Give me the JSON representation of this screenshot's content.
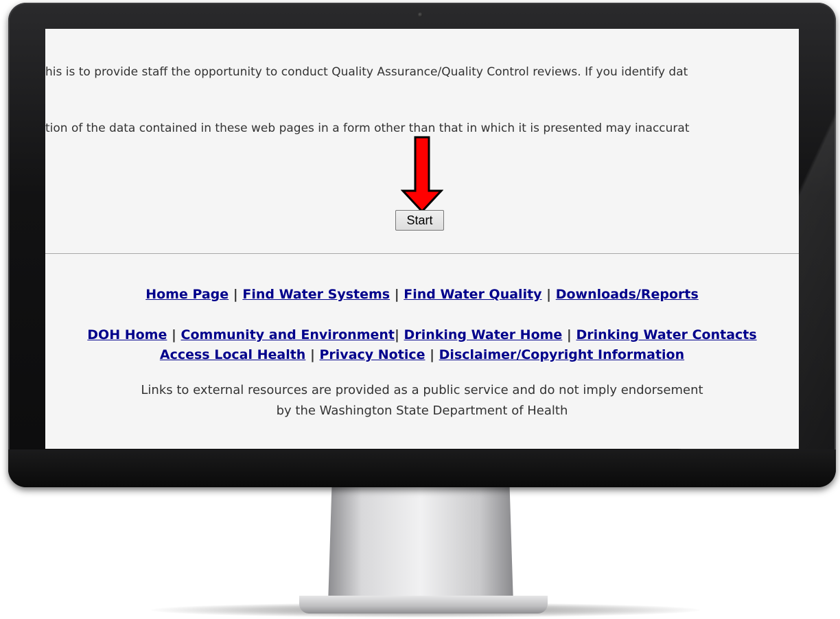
{
  "body_text": {
    "line1": "his is to provide staff the opportunity to conduct Quality Assurance/Quality Control reviews. If you identify dat",
    "line2": "tion of the data contained in these web pages in a form other than that in which it is presented may inaccurat"
  },
  "start_button": {
    "label": "Start"
  },
  "annotation": {
    "arrow_color": "#ff0000",
    "direction": "down"
  },
  "footer": {
    "separator": " | ",
    "primary_links": [
      {
        "label": "Home Page"
      },
      {
        "label": "Find Water Systems"
      },
      {
        "label": "Find Water Quality"
      },
      {
        "label": "Downloads/Reports"
      }
    ],
    "secondary_links": {
      "doh_home": "DOH Home",
      "community": "Community and Environment",
      "drinking_water_home": "Drinking Water Home",
      "drinking_water_contacts": "Drinking Water Contacts",
      "access_local_health": "Access Local Health",
      "privacy_notice": "Privacy Notice",
      "disclaimer": "Disclaimer/Copyright Information"
    },
    "notice_line1": "Links to external resources are provided as a public service and do not imply endorsement",
    "notice_line2": "by the Washington State Department of Health"
  },
  "colors": {
    "link": "#00008b",
    "screen_background": "#f5f5f5",
    "text": "#333333"
  }
}
